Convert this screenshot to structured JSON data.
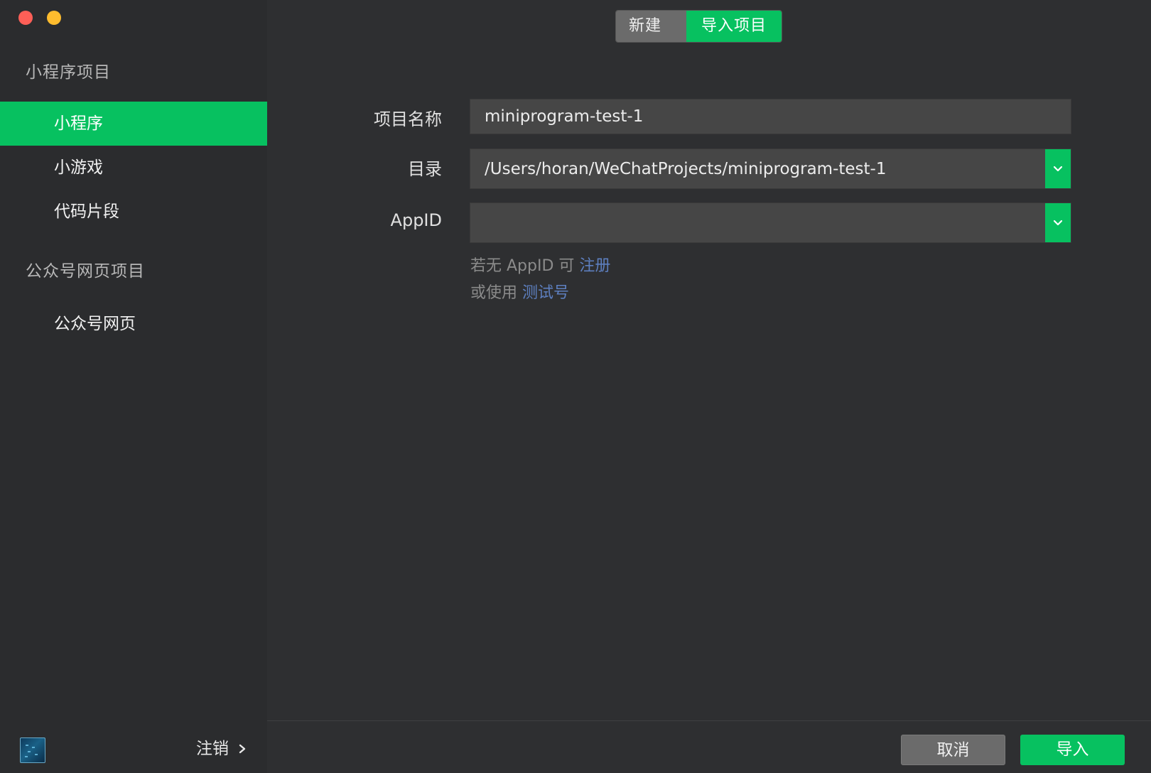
{
  "window": {
    "controls": [
      "close",
      "minimize"
    ]
  },
  "sidebar": {
    "sections": [
      {
        "title": "小程序项目",
        "items": [
          {
            "label": "小程序",
            "active": true
          },
          {
            "label": "小游戏",
            "active": false
          },
          {
            "label": "代码片段",
            "active": false
          }
        ]
      },
      {
        "title": "公众号网页项目",
        "items": [
          {
            "label": "公众号网页",
            "active": false
          }
        ]
      }
    ],
    "logout_label": "注销",
    "avatar_icon": "user-avatar"
  },
  "tabs": {
    "new_label": "新建项目",
    "import_label": "导入项目",
    "active": "导入项目"
  },
  "form": {
    "name_label": "项目名称",
    "name_value": "miniprogram-test-1",
    "dir_label": "目录",
    "dir_value": "/Users/horan/WeChatProjects/miniprogram-test-1",
    "appid_label": "AppID",
    "appid_value": "",
    "hint1_prefix": "若无 AppID 可 ",
    "hint1_link": "注册",
    "hint2_prefix": "或使用 ",
    "hint2_link": "测试号"
  },
  "footer": {
    "cancel_label": "取消",
    "import_label": "导入"
  },
  "colors": {
    "accent": "#07c160",
    "background": "#2e2f31",
    "sidebar": "#2b2c2e",
    "link": "#5d7fbf"
  }
}
